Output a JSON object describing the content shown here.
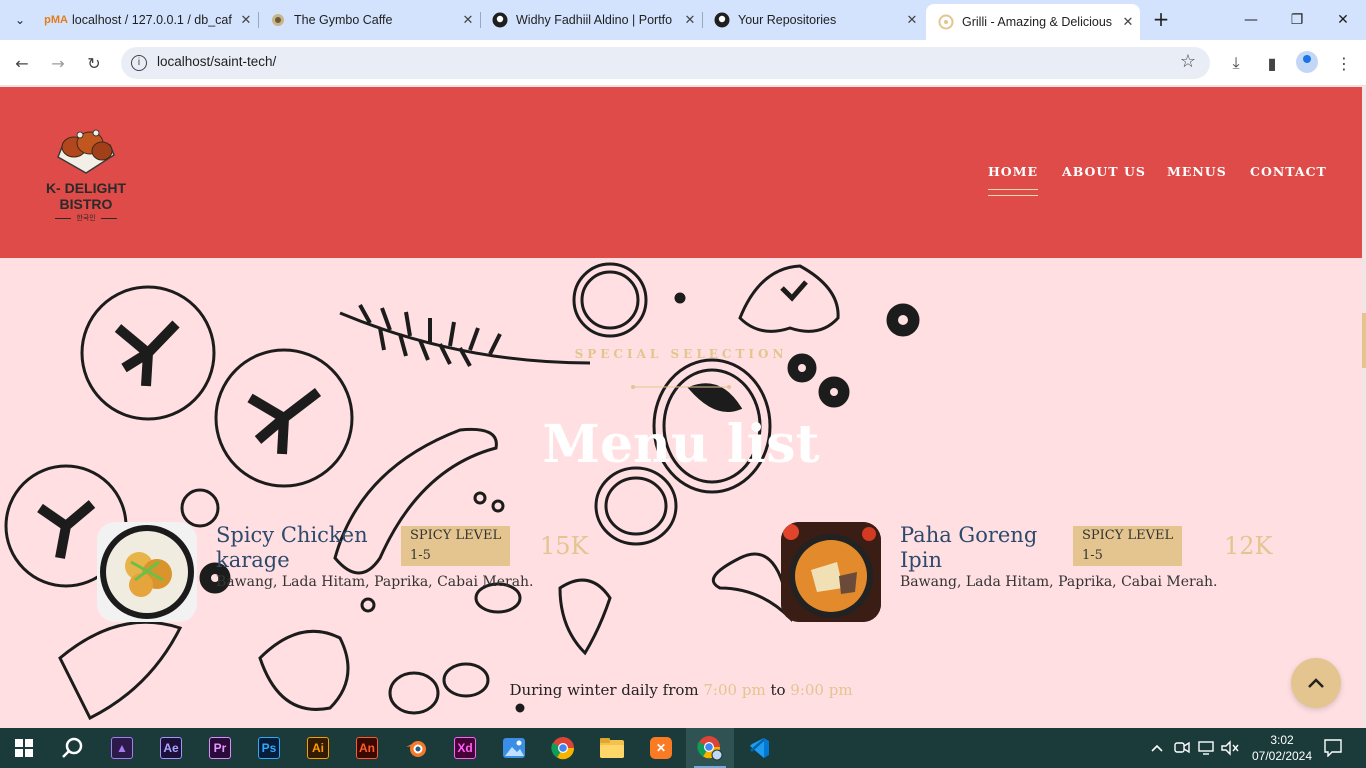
{
  "browser": {
    "tabs": [
      {
        "title": "localhost / 127.0.0.1 / db_caf",
        "icon": "phpmyadmin-icon"
      },
      {
        "title": "The Gymbo Caffe",
        "icon": "site-icon"
      },
      {
        "title": "Widhy Fadhiil Aldino | Portfo",
        "icon": "github-icon"
      },
      {
        "title": "Your Repositories",
        "icon": "github-icon"
      },
      {
        "title": "Grilli - Amazing & Delicious",
        "icon": "grilli-icon",
        "active": true
      }
    ],
    "url": "localhost/saint-tech/"
  },
  "site": {
    "logo": {
      "name": "K- DELIGHT\nBISTRO",
      "subtitle": "한국인"
    },
    "nav": [
      "HOME",
      "ABOUT US",
      "MENUS",
      "CONTACT"
    ],
    "active_nav": "HOME",
    "kicker": "SPECIAL SELECTION",
    "heading": "Menu list",
    "items": [
      {
        "name": "Spicy Chicken\nkarage",
        "badge": "SPICY LEVEL\n1-5",
        "price": "15K",
        "desc": "Bawang, Lada Hitam, Paprika, Cabai Merah."
      },
      {
        "name": "Paha Goreng\nIpin",
        "badge": "SPICY LEVEL\n1-5",
        "price": "12K",
        "desc": "Bawang, Lada Hitam, Paprika, Cabai Merah."
      }
    ],
    "hours": {
      "prefix": "During winter daily from ",
      "from": "7:00 pm",
      "mid": " to ",
      "to": "9:00 pm"
    }
  },
  "taskbar": {
    "apps": [
      "Windows Start",
      "Search",
      "Visual Studio",
      "After Effects",
      "Premiere Pro",
      "Photoshop",
      "Illustrator",
      "Animate",
      "Blender",
      "Adobe XD",
      "Photos",
      "Chrome",
      "File Explorer",
      "XAMPP",
      "Chrome Profile",
      "VS Code"
    ],
    "time": "3:02",
    "date": "07/02/2024"
  },
  "colors": {
    "header": "#de4b48",
    "page": "#ffdfe2",
    "gold": "#e4c590",
    "navy": "#2c4a6b",
    "taskbar": "#1b3a3a"
  }
}
